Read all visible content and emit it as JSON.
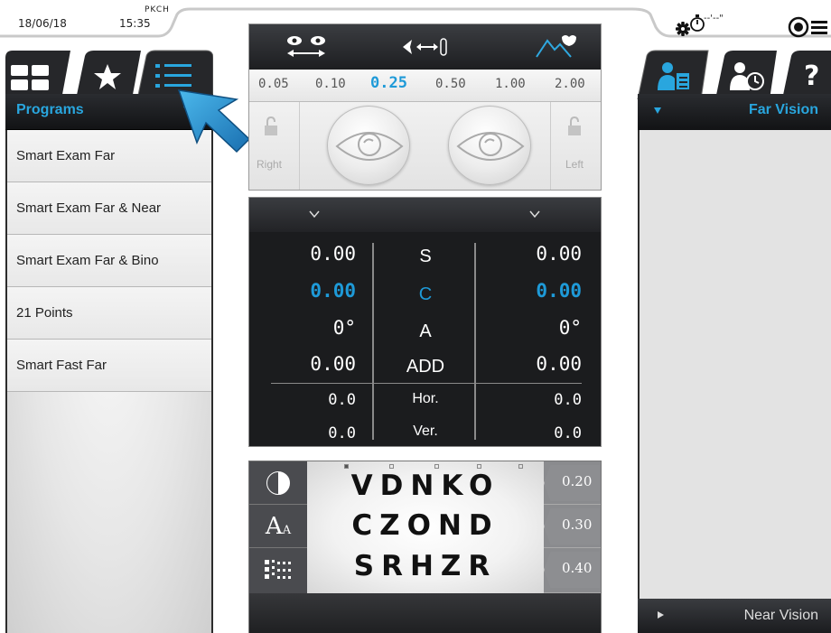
{
  "status_bar": {
    "date": "18/06/18",
    "time": "15:35",
    "user": "PKCH",
    "timer": "--'--\"",
    "icons": [
      "gear-icon",
      "stopwatch-icon",
      "target-menu-icon"
    ]
  },
  "left_panel": {
    "tabs": [
      {
        "icon": "grid-icon",
        "active": false
      },
      {
        "icon": "star-icon",
        "active": false
      },
      {
        "icon": "list-icon",
        "active": true
      }
    ],
    "header": "Programs",
    "programs": [
      "Smart Exam Far",
      "Smart Exam Far & Near",
      "Smart Exam Far & Bino",
      "21 Points",
      "Smart Fast Far"
    ]
  },
  "acuity_panel": {
    "mode_icons": [
      "binocular-eyes-icon",
      "distance-icon",
      "landscape-icon"
    ],
    "scale": [
      "0.05",
      "0.10",
      "0.25",
      "0.50",
      "1.00",
      "2.00"
    ],
    "selected_scale": "0.25",
    "right_label": "Right",
    "left_label": "Left"
  },
  "refraction": {
    "labels": {
      "sphere": "S",
      "cylinder": "C",
      "axis": "A",
      "add": "ADD",
      "hor": "Hor.",
      "ver": "Ver."
    },
    "right": {
      "sphere": "0.00",
      "cylinder": "0.00",
      "axis": "0°",
      "add": "0.00",
      "hor": "0.0",
      "ver": "0.0"
    },
    "left": {
      "sphere": "0.00",
      "cylinder": "0.00",
      "axis": "0°",
      "add": "0.00",
      "hor": "0.0",
      "ver": "0.0"
    }
  },
  "chart": {
    "tools": [
      "contrast-icon",
      "font-size-icon",
      "chart-pattern-icon"
    ],
    "font_tool_label": "A",
    "font_tool_sub": "A",
    "rows": [
      {
        "letters": "VDNKO",
        "acuity": "0.20"
      },
      {
        "letters": "CZOND",
        "acuity": "0.30"
      },
      {
        "letters": "SRHZR",
        "acuity": "0.40"
      }
    ]
  },
  "right_panel": {
    "tabs": [
      {
        "icon": "patient-record-icon",
        "active": true
      },
      {
        "icon": "patient-history-icon",
        "active": false
      },
      {
        "icon": "help-icon",
        "active": false
      }
    ],
    "header": "Far Vision",
    "footer": "Near Vision"
  },
  "colors": {
    "accent": "#1e9ad8",
    "dark": "#1b1c1e",
    "panel": "#e3e3e3"
  }
}
